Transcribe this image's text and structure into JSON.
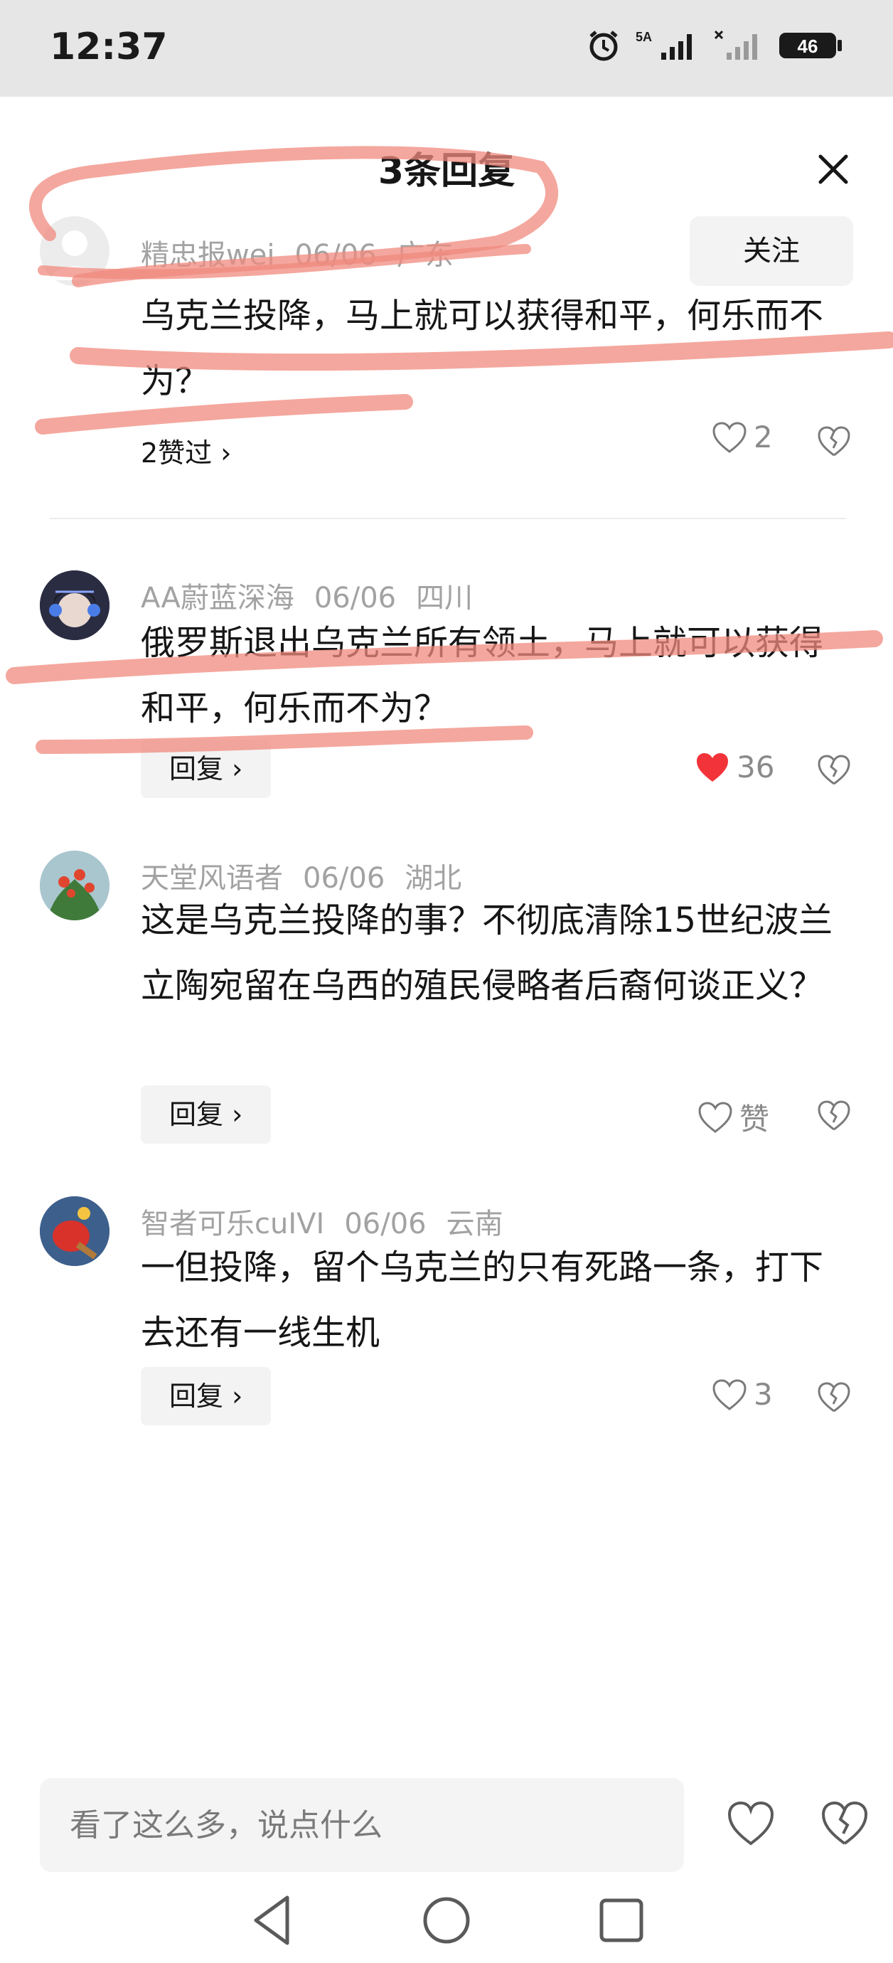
{
  "status_bar": {
    "time": "12:37",
    "network_label": "5A",
    "battery": "46"
  },
  "sheet": {
    "title": "3条回复"
  },
  "top_comment": {
    "username": "精忠报wei",
    "date": "06/06",
    "location": "广东",
    "follow_label": "关注",
    "text": "乌克兰投降，马上就可以获得和平，何乐而不为？",
    "likes_summary": "2赞过 ›",
    "like_count": "2"
  },
  "replies": [
    {
      "username": "AA蔚蓝深海",
      "date": "06/06",
      "location": "四川",
      "text": "俄罗斯退出乌克兰所有领土，马上就可以获得和平，何乐而不为？",
      "reply_label": "回复 ›",
      "like_count": "36",
      "liked": true
    },
    {
      "username": "天堂风语者",
      "date": "06/06",
      "location": "湖北",
      "text": "这是乌克兰投降的事？不彻底清除15世纪波兰立陶宛留在乌西的殖民侵略者后裔何谈正义？",
      "reply_label": "回复 ›",
      "like_count": "赞",
      "liked": false
    },
    {
      "username": "智者可乐cuIVI",
      "date": "06/06",
      "location": "云南",
      "text": "一但投降，留个乌克兰的只有死路一条，打下去还有一线生机",
      "reply_label": "回复 ›",
      "like_count": "3",
      "liked": false
    }
  ],
  "bottom_bar": {
    "input_placeholder": "看了这么多，说点什么"
  },
  "colors": {
    "liked_heart": "#f2343a",
    "annotation_highlight": "#f08a7e",
    "status_bar_bg": "#e6e6e6"
  },
  "icons": [
    "alarm-icon",
    "signal-icon",
    "battery-icon",
    "close-icon",
    "heart-icon",
    "broken-heart-icon",
    "back-nav-icon",
    "home-nav-icon",
    "recents-nav-icon"
  ]
}
